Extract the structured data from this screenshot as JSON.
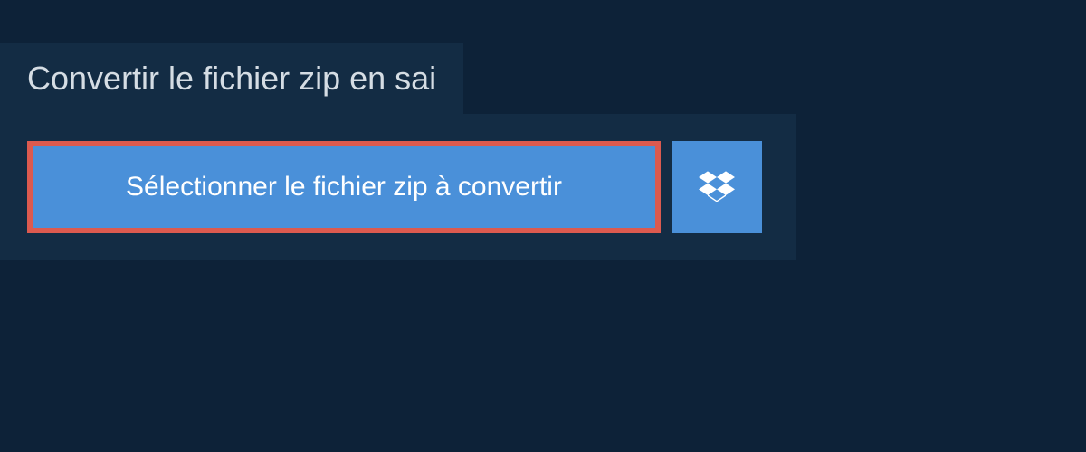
{
  "header": {
    "title": "Convertir le fichier zip en sai"
  },
  "actions": {
    "select_file_label": "Sélectionner le fichier zip à convertir"
  },
  "colors": {
    "background": "#0d2238",
    "panel": "#132c44",
    "button": "#4a90d9",
    "highlight_border": "#dc5a4f"
  }
}
